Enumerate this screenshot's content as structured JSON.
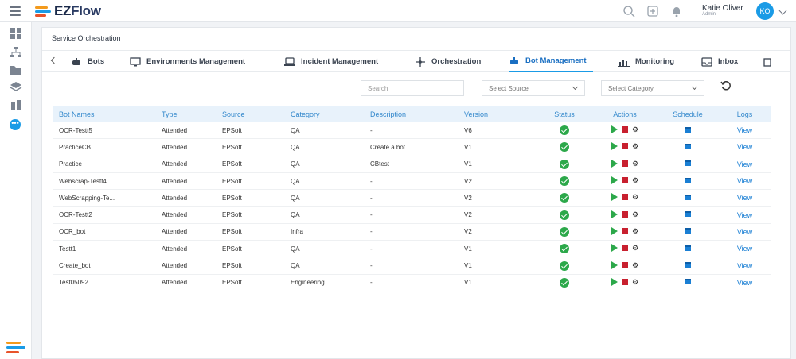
{
  "app": {
    "logo_text_ez": "EZ",
    "logo_text_flow": "Flow"
  },
  "user": {
    "name": "Katie Oliver",
    "role": "Admin",
    "initials": "KO"
  },
  "page": {
    "section_title": "Service Orchestration"
  },
  "tabs": [
    {
      "label": "Bots",
      "icon": "robot-icon"
    },
    {
      "label": "Environments Management",
      "icon": "monitor-icon"
    },
    {
      "label": "Incident Management",
      "icon": "laptop-icon"
    },
    {
      "label": "Orchestration",
      "icon": "move-icon"
    },
    {
      "label": "Bot Management",
      "icon": "robot-icon",
      "active": true
    },
    {
      "label": "Monitoring",
      "icon": "bar-chart-icon"
    },
    {
      "label": "Inbox",
      "icon": "inbox-icon"
    }
  ],
  "filters": {
    "search_placeholder": "Search",
    "source_select": "Select Source",
    "category_select": "Select Category"
  },
  "table": {
    "headers": [
      "Bot Names",
      "Type",
      "Source",
      "Category",
      "Description",
      "Version",
      "Status",
      "Actions",
      "Schedule",
      "Logs"
    ],
    "rows": [
      [
        "OCR-Testt5",
        "Attended",
        "EPSoft",
        "QA",
        "-",
        "V6",
        "View"
      ],
      [
        "PracticeCB",
        "Attended",
        "EPSoft",
        "QA",
        "Create a bot",
        "V1",
        "View"
      ],
      [
        "Practice",
        "Attended",
        "EPSoft",
        "QA",
        "CBtest",
        "V1",
        "View"
      ],
      [
        "Webscrap-Testt4",
        "Attended",
        "EPSoft",
        "QA",
        "-",
        "V2",
        "View"
      ],
      [
        "WebScrapping-Te...",
        "Attended",
        "EPSoft",
        "QA",
        "-",
        "V2",
        "View"
      ],
      [
        "OCR-Testt2",
        "Attended",
        "EPSoft",
        "QA",
        "-",
        "V2",
        "View"
      ],
      [
        "OCR_bot",
        "Attended",
        "EPSoft",
        "Infra",
        "-",
        "V2",
        "View"
      ],
      [
        "Testt1",
        "Attended",
        "EPSoft",
        "QA",
        "-",
        "V1",
        "View"
      ],
      [
        "Create_bot",
        "Attended",
        "EPSoft",
        "QA",
        "-",
        "V1",
        "View"
      ],
      [
        "Test05092",
        "Attended",
        "EPSoft",
        "Engineering",
        "-",
        "V1",
        "View"
      ]
    ]
  },
  "colors": {
    "accent": "#1a9be6",
    "success": "#2ca84a",
    "danger": "#c8202f",
    "header_bg": "#e8f2fb"
  }
}
